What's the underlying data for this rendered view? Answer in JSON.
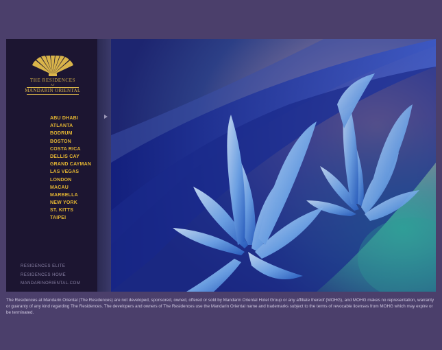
{
  "brand": {
    "line1": "THE RESIDENCES",
    "line2": "AT",
    "line3": "MANDARIN ORIENTAL",
    "color": "#d9b44a"
  },
  "cities": [
    "ABU DHABI",
    "ATLANTA",
    "BODRUM",
    "BOSTON",
    "COSTA RICA",
    "DELLIS CAY",
    "GRAND CAYMAN",
    "LAS VEGAS",
    "LONDON",
    "MACAU",
    "MARBELLA",
    "NEW YORK",
    "ST. KITTS",
    "TAIPEI"
  ],
  "footer_links": [
    "RESIDENCES ELITE",
    "RESIDENCES HOME",
    "MANDARINORIENTAL.COM"
  ],
  "disclaimer": "The Residences at Mandarin Oriental (The Residences) are not developed, sponsored, owned, offered or sold by Mandarin Oriental Hotel Group or any affiliate thereof (MOHG), and MOHG makes no representation, warranty or guaranty of any kind regarding The Residences. The developers and owners of The Residences use the Mandarin Oriental name and trademarks subject to the terms of revocable licenses from MOHG which may expire or be terminated.",
  "icons": {
    "logo": "fan-logo-icon",
    "expand": "play-arrow-icon"
  },
  "colors": {
    "background": "#4b3f6b",
    "sidebar": "#1c1531",
    "city_text": "#e3b533"
  }
}
